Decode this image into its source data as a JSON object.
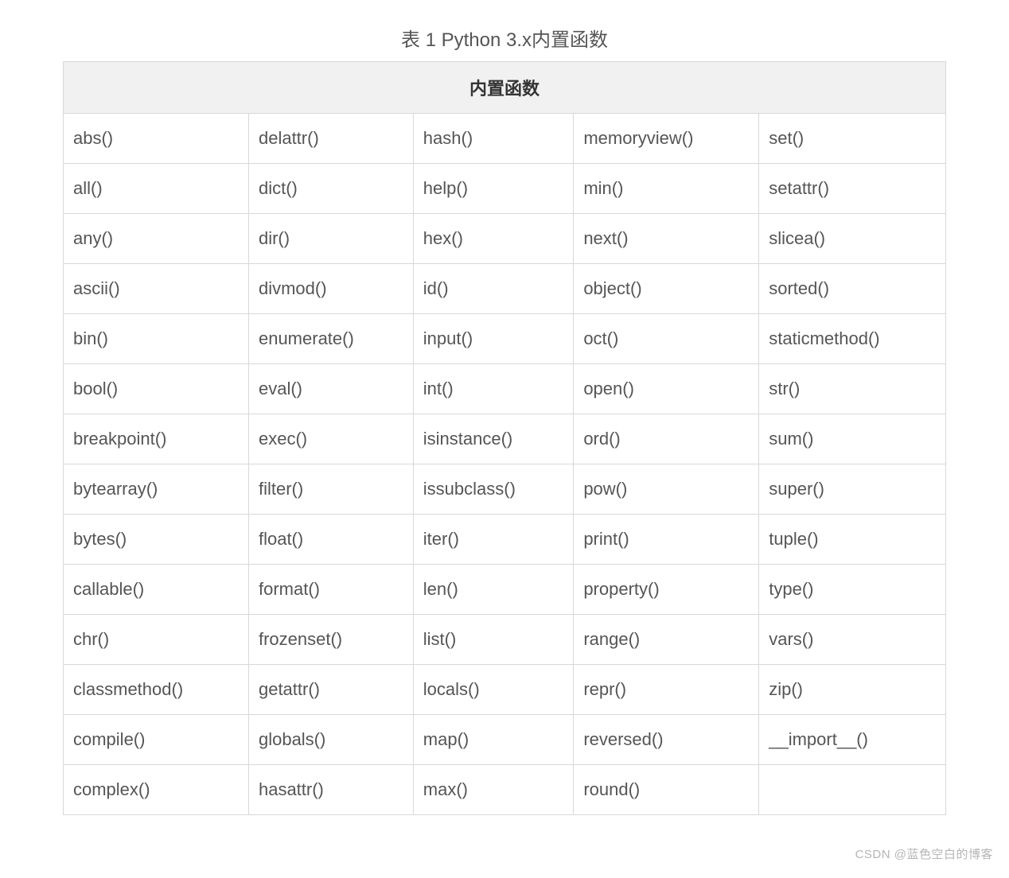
{
  "caption": "表 1 Python 3.x内置函数",
  "header": "内置函数",
  "rows": [
    [
      "abs()",
      "delattr()",
      "hash()",
      "memoryview()",
      "set()"
    ],
    [
      "all()",
      "dict()",
      "help()",
      "min()",
      "setattr()"
    ],
    [
      "any()",
      "dir()",
      "hex()",
      "next()",
      "slicea()"
    ],
    [
      "ascii()",
      "divmod()",
      "id()",
      "object()",
      "sorted()"
    ],
    [
      "bin()",
      "enumerate()",
      "input()",
      "oct()",
      "staticmethod()"
    ],
    [
      "bool()",
      "eval()",
      "int()",
      "open()",
      "str()"
    ],
    [
      "breakpoint()",
      "exec()",
      "isinstance()",
      "ord()",
      "sum()"
    ],
    [
      "bytearray()",
      "filter()",
      "issubclass()",
      "pow()",
      "super()"
    ],
    [
      "bytes()",
      "float()",
      "iter()",
      "print()",
      "tuple()"
    ],
    [
      "callable()",
      "format()",
      "len()",
      "property()",
      "type()"
    ],
    [
      "chr()",
      "frozenset()",
      "list()",
      "range()",
      "vars()"
    ],
    [
      "classmethod()",
      "getattr()",
      "locals()",
      "repr()",
      "zip()"
    ],
    [
      "compile()",
      "globals()",
      "map()",
      "reversed()",
      "__import__()"
    ],
    [
      "complex()",
      "hasattr()",
      "max()",
      "round()",
      ""
    ]
  ],
  "watermark": "CSDN @蓝色空白的博客"
}
